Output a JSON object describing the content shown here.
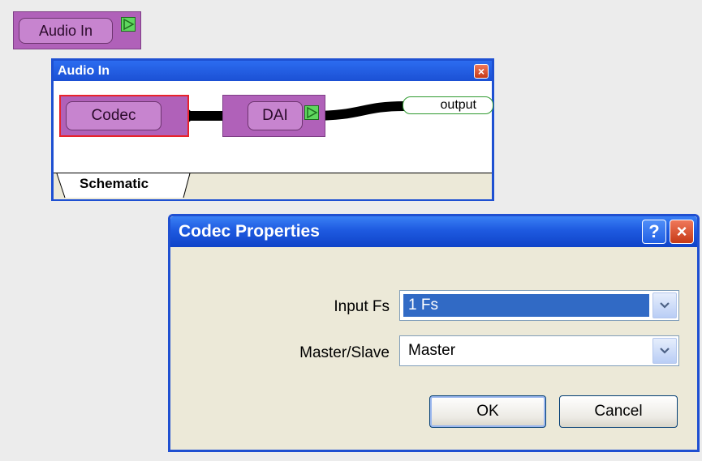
{
  "top_block": {
    "label": "Audio In"
  },
  "audio_window": {
    "title": "Audio In",
    "close_glyph": "×",
    "blocks": {
      "codec": "Codec",
      "dai": "DAI"
    },
    "output_port": "output",
    "tab": "Schematic"
  },
  "dialog": {
    "title": "Codec Properties",
    "help_glyph": "?",
    "close_glyph": "×",
    "fields": {
      "input_fs": {
        "label": "Input Fs",
        "value": "1 Fs"
      },
      "master_slave": {
        "label": "Master/Slave",
        "value": "Master"
      }
    },
    "buttons": {
      "ok": "OK",
      "cancel": "Cancel"
    }
  },
  "icons": {
    "out_port": "play-triangle-icon",
    "dropdown": "chevron-down-icon",
    "close": "close-icon",
    "help": "help-icon"
  },
  "colors": {
    "block": "#b061b9",
    "block_pill": "#c784cf",
    "selected_outline": "#e8232b",
    "port": "#5fd75f",
    "titlebar": "#1e5ae0",
    "selection": "#316ac5"
  }
}
